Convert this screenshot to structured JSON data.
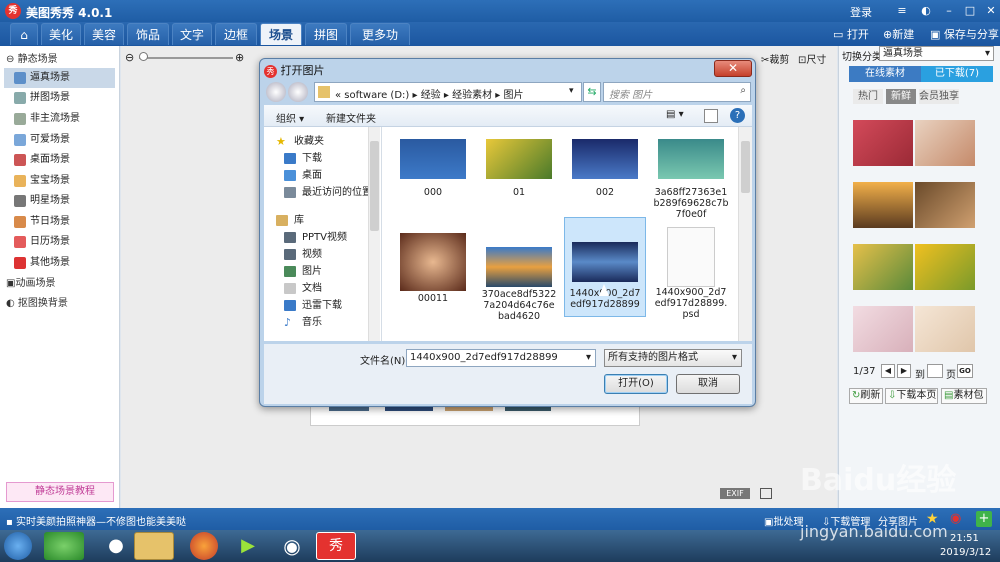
{
  "app": {
    "logo": "秀",
    "title": "美图秀秀 4.0.1",
    "login": "登录"
  },
  "nav": {
    "tabs": [
      "美化",
      "美容",
      "饰品",
      "文字",
      "边框",
      "场景",
      "拼图",
      "更多功能 ▾"
    ],
    "active": "场景",
    "open": "打开",
    "new": "新建",
    "save": "保存与分享"
  },
  "left": {
    "static_head": "静态场景",
    "items": [
      "逼真场景",
      "拼图场景",
      "非主流场景",
      "可爱场景",
      "桌面场景",
      "宝宝场景",
      "明星场景",
      "节日场景",
      "日历场景",
      "其他场景"
    ],
    "selected": "逼真场景",
    "anim": "动画场景",
    "cutout": "抠图换背景",
    "tutorial": "静态场景教程"
  },
  "toolbar": {
    "crop": "裁剪",
    "size": "尺寸"
  },
  "right": {
    "category_label": "切换分类",
    "category_value": "逼真场景",
    "tab_online": "在线素材",
    "tab_downloaded": "已下载(7)",
    "sub": [
      "热门",
      "新鲜",
      "会员独享"
    ],
    "sub_active": "新鲜",
    "page": "1/37",
    "to": "到",
    "page_unit": "页",
    "go": "GO",
    "refresh": "刷新",
    "download_page": "下载本页",
    "bag": "素材包"
  },
  "status": {
    "left": "实时美颜拍照神器—不修图也能美美哒",
    "batch": "批处理",
    "download": "下载管理",
    "share": "分享图片"
  },
  "taskbar": {
    "time": "21:51",
    "date": "2019/3/12"
  },
  "watermark": {
    "text": "Baidu经验",
    "url": "jingyan.baidu.com"
  },
  "dialog": {
    "title": "打开图片",
    "path": [
      "software (D:)",
      "经验",
      "经验素材",
      "图片"
    ],
    "search_placeholder": "搜索 图片",
    "organize": "组织 ▾",
    "new_folder": "新建文件夹",
    "nav": [
      {
        "label": "收藏夹",
        "icon": "star-icon"
      },
      {
        "label": "下载",
        "icon": "download-folder-icon"
      },
      {
        "label": "桌面",
        "icon": "desktop-icon"
      },
      {
        "label": "最近访问的位置",
        "icon": "recent-icon"
      },
      {
        "label": "库",
        "icon": "library-icon"
      },
      {
        "label": "PPTV视频",
        "icon": "video-library-icon"
      },
      {
        "label": "视频",
        "icon": "video-library-icon"
      },
      {
        "label": "图片",
        "icon": "pictures-library-icon"
      },
      {
        "label": "文档",
        "icon": "documents-library-icon"
      },
      {
        "label": "迅雷下载",
        "icon": "download-folder-icon"
      },
      {
        "label": "音乐",
        "icon": "music-library-icon"
      }
    ],
    "files": [
      {
        "name": "000"
      },
      {
        "name": "01"
      },
      {
        "name": "002"
      },
      {
        "name": "3a68ff27363e1b289f69628c7b7f0e0f"
      },
      {
        "name": "00011"
      },
      {
        "name": "370ace8df53227a204d64c76ebad4620"
      },
      {
        "name": "1440x900_2d7edf917d28899"
      },
      {
        "name": "1440x900_2d7edf917d28899.psd"
      }
    ],
    "selected_file": "1440x900_2d7edf917d28899",
    "filename_label": "文件名(N):",
    "filename_value": "1440x900_2d7edf917d28899",
    "filetype": "所有支持的图片格式",
    "open": "打开(O)",
    "cancel": "取消"
  }
}
